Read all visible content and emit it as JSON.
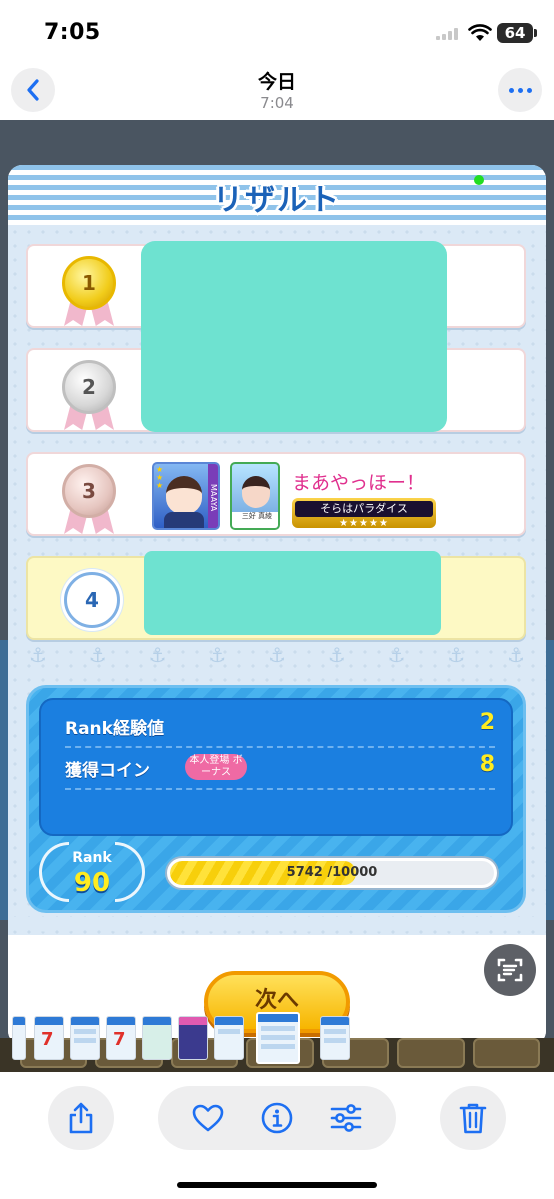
{
  "status_bar": {
    "time": "7:05",
    "battery": "64"
  },
  "header": {
    "title": "今日",
    "subtitle": "7:04"
  },
  "game": {
    "title": "リザルト",
    "results": [
      {
        "place": "1",
        "medal": "gold"
      },
      {
        "place": "2",
        "medal": "silver"
      },
      {
        "place": "3",
        "medal": "bronze",
        "player_name": "まあやっほー！",
        "badge": "そらはパラダイス",
        "badge_stars": "★★★★★",
        "card_side_label": "MAAYA",
        "card_name": "三好 真綾"
      },
      {
        "place": "4"
      }
    ],
    "summary": {
      "rank_exp_label": "Rank経験値",
      "rank_exp_value": "2",
      "coin_label": "獲得コイン",
      "coin_value": "8",
      "bonus_label": "本人登場 ボーナス",
      "rank_label": "Rank",
      "rank_value": "90",
      "xp_text": "5742 /10000",
      "xp_progress": 0.5742
    },
    "next_button": "次へ"
  },
  "toolbar": {
    "icons": [
      "share-icon",
      "heart-icon",
      "info-icon",
      "adjust-icon",
      "trash-icon"
    ]
  },
  "colors": {
    "accent": "#1d6ff2",
    "mask": "#6ee2d0",
    "title_blue": "#1b62b8",
    "pink_name": "#e0308e"
  }
}
